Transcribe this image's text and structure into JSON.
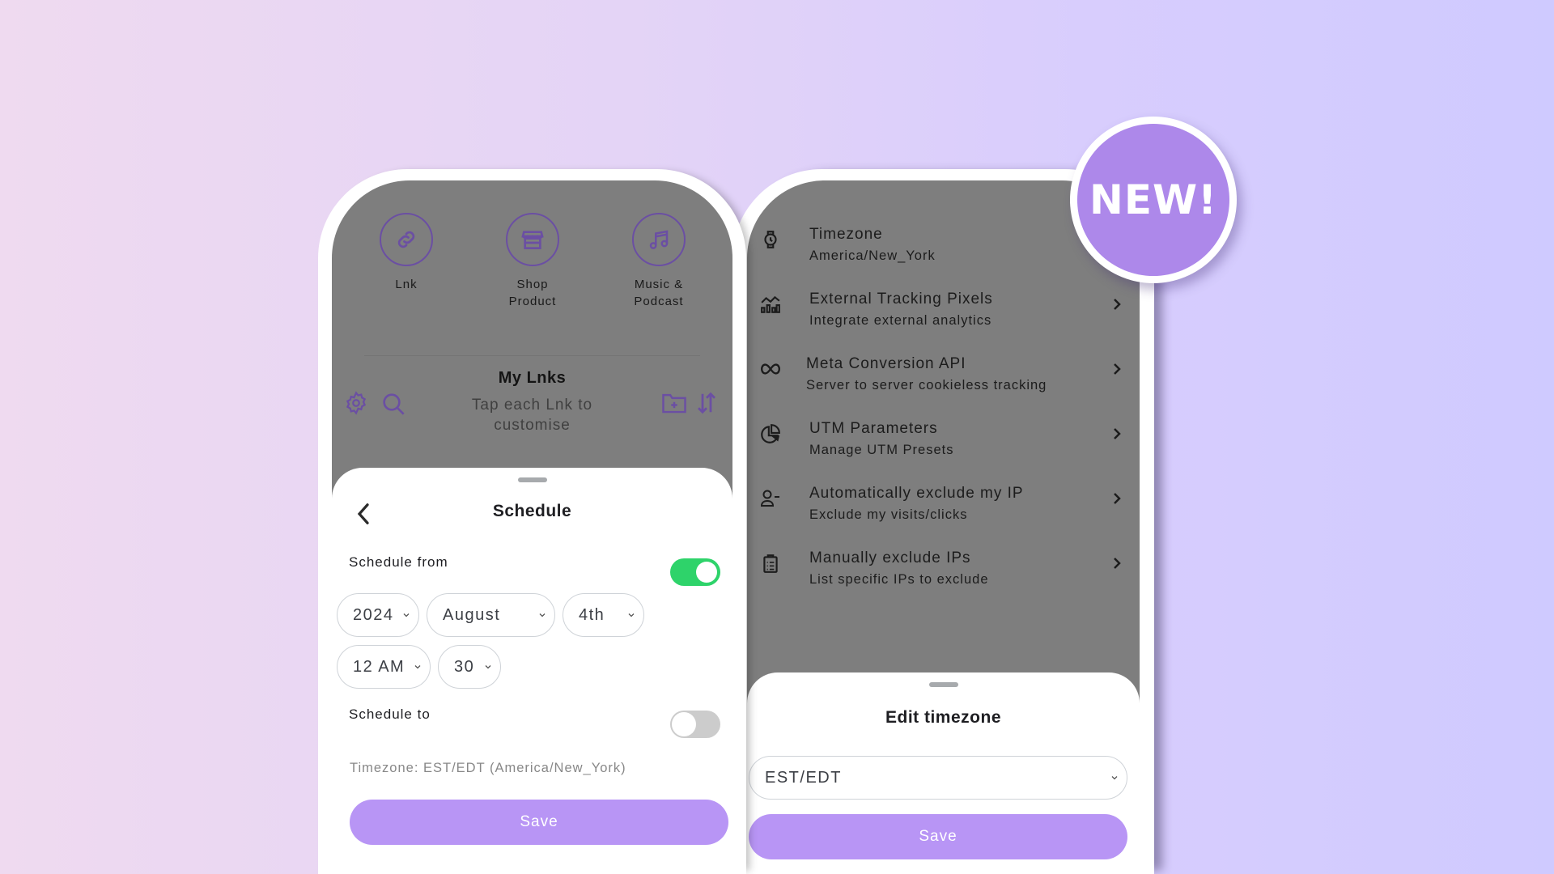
{
  "colors": {
    "accent": "#b895f5",
    "icon_purple": "#6b4fa3",
    "toggle_on": "#2ed36a",
    "toggle_off": "#cccccc",
    "badge": "#ad88ea",
    "overlay_gray": "#7e7e7e"
  },
  "badge": {
    "text": "NEW!"
  },
  "left_phone": {
    "quick_actions": [
      {
        "icon": "link-icon",
        "label_lines": [
          "Lnk"
        ]
      },
      {
        "icon": "storefront-icon",
        "label_lines": [
          "Shop",
          "Product"
        ]
      },
      {
        "icon": "music-note-icon",
        "label_lines": [
          "Music &",
          "Podcast"
        ]
      }
    ],
    "my_lnks": {
      "title": "My Lnks",
      "subtitle_lines": [
        "Tap each Lnk to",
        "customise"
      ],
      "left_icons": [
        "gear-icon",
        "search-icon"
      ],
      "right_icons": [
        "folder-add-icon",
        "sort-icon"
      ]
    },
    "schedule_sheet": {
      "title": "Schedule",
      "schedule_from": {
        "label": "Schedule from",
        "enabled": true
      },
      "date": {
        "year": "2024",
        "month": "August",
        "day": "4th"
      },
      "time": {
        "hour": "12 AM",
        "minute": "30"
      },
      "schedule_to": {
        "label": "Schedule to",
        "enabled": false
      },
      "timezone_note": "Timezone: EST/EDT (America/New_York)",
      "save_label": "Save"
    }
  },
  "right_phone": {
    "settings_items": [
      {
        "icon": "watch-icon",
        "title": "Timezone",
        "subtitle": "America/New_York",
        "has_chevron": false
      },
      {
        "icon": "analytics-icon",
        "title": "External Tracking Pixels",
        "subtitle": "Integrate external analytics",
        "has_chevron": true
      },
      {
        "icon": "meta-infinity-icon",
        "title": "Meta Conversion API",
        "subtitle": "Server to server cookieless tracking",
        "has_chevron": true
      },
      {
        "icon": "pie-chart-icon",
        "title": "UTM Parameters",
        "subtitle": "Manage UTM Presets",
        "has_chevron": true
      },
      {
        "icon": "user-remove-icon",
        "title": "Automatically exclude my IP",
        "subtitle": "Exclude my visits/clicks",
        "has_chevron": true
      },
      {
        "icon": "clipboard-list-icon",
        "title": "Manually exclude IPs",
        "subtitle": "List specific IPs to exclude",
        "has_chevron": true
      }
    ],
    "timezone_sheet": {
      "title": "Edit timezone",
      "selected": "EST/EDT",
      "save_label": "Save"
    }
  }
}
